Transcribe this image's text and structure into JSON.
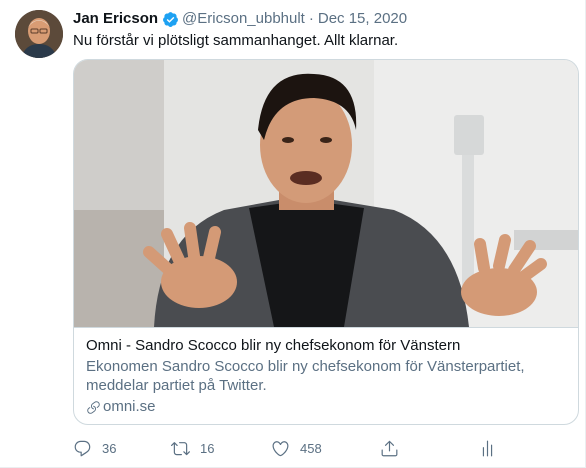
{
  "tweet": {
    "author_name": "Jan Ericson",
    "handle": "@Ericson_ubbhult",
    "separator": "·",
    "date": "Dec 15, 2020",
    "text": "Nu förstår vi plötsligt sammanhanget. Allt klarnar."
  },
  "card": {
    "title": "Omni - Sandro Scocco blir ny chefsekonom för Vänstern",
    "description": "Ekonomen Sandro Scocco blir ny chefsekonom för Vänsterpartiet, meddelar partiet på Twitter.",
    "domain": "omni.se"
  },
  "actions": {
    "reply_count": "36",
    "retweet_count": "16",
    "like_count": "458"
  },
  "icons": {
    "verified": "verified-badge-icon",
    "link": "link-icon",
    "reply": "reply-icon",
    "retweet": "retweet-icon",
    "like": "heart-icon",
    "share": "share-icon",
    "analytics": "analytics-icon"
  },
  "colors": {
    "verified": "#1da1f2",
    "secondary_text": "#5b7083",
    "primary_text": "#0f1419",
    "border": "#cfd9de"
  }
}
